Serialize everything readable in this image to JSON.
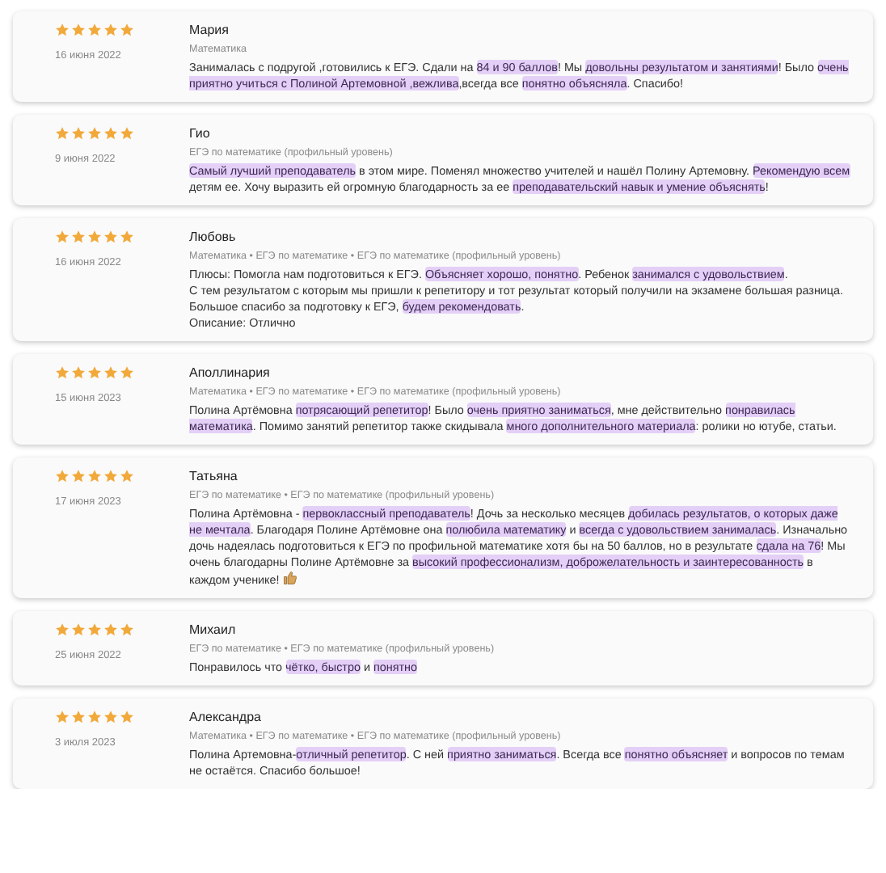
{
  "reviews": [
    {
      "stars": 5,
      "date": "16 июня 2022",
      "name": "Мария",
      "subjects": "Математика",
      "thumbs_up": false,
      "paragraphs": [
        [
          {
            "text": "Занималась с подругой ,готовились к ЕГЭ. Сдали на ",
            "highlighted": false
          },
          {
            "text": "84 и 90 баллов",
            "highlighted": true
          },
          {
            "text": "! Мы ",
            "highlighted": false
          },
          {
            "text": "довольны результатом и занятиями",
            "highlighted": true
          },
          {
            "text": "! Было ",
            "highlighted": false
          },
          {
            "text": "очень приятно учиться с Полиной Артемовной ,вежлива",
            "highlighted": true
          },
          {
            "text": ",всегда все ",
            "highlighted": false
          },
          {
            "text": "понятно объясняла",
            "highlighted": true
          },
          {
            "text": ". Спасибо!",
            "highlighted": false
          }
        ]
      ]
    },
    {
      "stars": 5,
      "date": "9 июня 2022",
      "name": "Гио",
      "subjects": "ЕГЭ по математике (профильный уровень)",
      "thumbs_up": false,
      "paragraphs": [
        [
          {
            "text": "Самый лучший преподаватель",
            "highlighted": true
          },
          {
            "text": " в этом мире. Поменял множество учителей и нашёл Полину Артемовну. ",
            "highlighted": false
          },
          {
            "text": "Рекомендую всем",
            "highlighted": true
          },
          {
            "text": " детям ее. Хочу выразить ей огромную благодарность за ее ",
            "highlighted": false
          },
          {
            "text": "преподавательский навык и умение объяснять",
            "highlighted": true
          },
          {
            "text": "!",
            "highlighted": false
          }
        ]
      ]
    },
    {
      "stars": 5,
      "date": "16 июня 2022",
      "name": "Любовь",
      "subjects": "Математика • ЕГЭ по математике • ЕГЭ по математике (профильный уровень)",
      "thumbs_up": false,
      "paragraphs": [
        [
          {
            "text": "Плюсы: Помогла нам подготовиться к ЕГЭ. ",
            "highlighted": false
          },
          {
            "text": "Объясняет хорошо, понятно",
            "highlighted": true
          },
          {
            "text": ". Ребенок ",
            "highlighted": false
          },
          {
            "text": "занимался с удовольствием",
            "highlighted": true
          },
          {
            "text": ".",
            "highlighted": false
          }
        ],
        [
          {
            "text": "С тем результатом с которым мы пришли к репетитору и тот результат который получили на экзамене большая разница. Большое спасибо за подготовку к ЕГЭ, ",
            "highlighted": false
          },
          {
            "text": "будем рекомендовать",
            "highlighted": true
          },
          {
            "text": ".",
            "highlighted": false
          }
        ],
        [
          {
            "text": "Описание: Отлично",
            "highlighted": false
          }
        ]
      ]
    },
    {
      "stars": 5,
      "date": "15 июня 2023",
      "name": "Аполлинария",
      "subjects": "Математика • ЕГЭ по математике • ЕГЭ по математике (профильный уровень)",
      "thumbs_up": false,
      "paragraphs": [
        [
          {
            "text": "Полина Артёмовна ",
            "highlighted": false
          },
          {
            "text": "потрясающий репетитор",
            "highlighted": true
          },
          {
            "text": "! Было ",
            "highlighted": false
          },
          {
            "text": "очень приятно заниматься",
            "highlighted": true
          },
          {
            "text": ", мне действительно ",
            "highlighted": false
          },
          {
            "text": "понравилась математика",
            "highlighted": true
          },
          {
            "text": ". Помимо занятий репетитор также скидывала ",
            "highlighted": false
          },
          {
            "text": "много дополнительного материала",
            "highlighted": true
          },
          {
            "text": ": ролики но ютубе, статьи.",
            "highlighted": false
          }
        ]
      ]
    },
    {
      "stars": 5,
      "date": "17 июня 2023",
      "name": "Татьяна",
      "subjects": "ЕГЭ по математике • ЕГЭ по математике (профильный уровень)",
      "thumbs_up": true,
      "paragraphs": [
        [
          {
            "text": "Полина Артёмовна - ",
            "highlighted": false
          },
          {
            "text": "первоклассный преподаватель",
            "highlighted": true
          },
          {
            "text": "! Дочь за несколько месяцев ",
            "highlighted": false
          },
          {
            "text": "добилась результатов, о которых даже не мечтала",
            "highlighted": true
          },
          {
            "text": ". Благодаря Полине Артёмовне она ",
            "highlighted": false
          },
          {
            "text": "полюбила математику",
            "highlighted": true
          },
          {
            "text": " и ",
            "highlighted": false
          },
          {
            "text": "всегда с удовольствием занималась",
            "highlighted": true
          },
          {
            "text": ". Изначально дочь надеялась подготовиться к ЕГЭ по профильной математике хотя бы на 50 баллов, но в результате ",
            "highlighted": false
          },
          {
            "text": "сдала на 76",
            "highlighted": true
          },
          {
            "text": "! Мы очень благодарны Полине Артёмовне за ",
            "highlighted": false
          },
          {
            "text": "высокий профессионализм, доброжелательность и заинтересованность",
            "highlighted": true
          },
          {
            "text": " в каждом ученике!",
            "highlighted": false
          }
        ]
      ]
    },
    {
      "stars": 5,
      "date": "25 июня 2022",
      "name": "Михаил",
      "subjects": "ЕГЭ по математике • ЕГЭ по математике (профильный уровень)",
      "thumbs_up": false,
      "paragraphs": [
        [
          {
            "text": "Понравилось что ",
            "highlighted": false
          },
          {
            "text": "чётко, быстро",
            "highlighted": true
          },
          {
            "text": " и ",
            "highlighted": false
          },
          {
            "text": "понятно",
            "highlighted": true
          }
        ]
      ]
    },
    {
      "stars": 5,
      "date": "3 июля 2023",
      "name": "Александра",
      "subjects": "Математика • ЕГЭ по математике • ЕГЭ по математике (профильный уровень)",
      "thumbs_up": false,
      "paragraphs": [
        [
          {
            "text": "Полина Артемовна-",
            "highlighted": false
          },
          {
            "text": "отличный репетитор",
            "highlighted": true
          },
          {
            "text": ". С ней ",
            "highlighted": false
          },
          {
            "text": "приятно заниматься",
            "highlighted": true
          },
          {
            "text": ". Всегда все ",
            "highlighted": false
          },
          {
            "text": "понятно объясняет",
            "highlighted": true
          },
          {
            "text": " и вопросов по темам не остаётся. Спасибо большое!",
            "highlighted": false
          }
        ]
      ]
    }
  ]
}
